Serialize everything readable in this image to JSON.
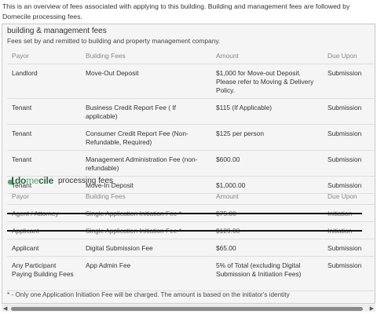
{
  "intro": "This is an overview of fees associated with applying to this building. Building and management fees are followed by Domecile processing fees.",
  "building": {
    "title": "building & management fees",
    "subtitle": "Fees set by and remitted to building and property management company.",
    "headers": [
      "Payor",
      "Building Fees",
      "Amount",
      "Due Upon"
    ],
    "rows": [
      [
        "Landlord",
        "Move-Out Deposit",
        "$1,000 for Move-out Deposit. Please refer to Moving & Delivery Policy.",
        "Submission"
      ],
      [
        "Tenant",
        "Business Credit Report Fee ( If applicable)",
        "$115 (If Applicable)",
        "Submission"
      ],
      [
        "Tenant",
        "Consumer Credit Report Fee (Non-Refundable, Required)",
        "$125 per person",
        "Submission"
      ],
      [
        "Tenant",
        "Management Administration Fee (non-refundable)",
        "$600.00",
        "Submission"
      ],
      [
        "Tenant",
        "Move-In Deposit",
        "$1,000.00",
        "Submission"
      ]
    ]
  },
  "domecile": {
    "logo_a": "do",
    "logo_b": "me",
    "logo_c": "cile",
    "title": "processing fees",
    "headers": [
      "Payor",
      "Building Fees",
      "Amount",
      "Due Upon"
    ],
    "rows": [
      [
        "Agent / Attorney",
        "Single Application Initiation Fee *",
        "$75.00",
        "Initiation"
      ],
      [
        "Applicant",
        "Single Application Initiation Fee *",
        "$129.00",
        "Initiation"
      ],
      [
        "Applicant",
        "Digital Submission Fee",
        "$65.00",
        "Submission"
      ],
      [
        "Any Participant Paying Building Fees",
        "App Admin Fee",
        "5% of Total (excluding Digital Submission & Initiation Fees)",
        "Submission"
      ]
    ],
    "struck_rows": [
      0,
      1
    ]
  },
  "footnote": "* - Only one Application Initiation Fee will be charged. The amount is based on the initiator's identity",
  "colors": {
    "logo_dark": "#2e6b45",
    "logo_light": "#5aa86d",
    "panel_bg": "#f5f5f5"
  },
  "icons": {
    "scroll_left": "triangle-left",
    "scroll_right": "triangle-right"
  }
}
